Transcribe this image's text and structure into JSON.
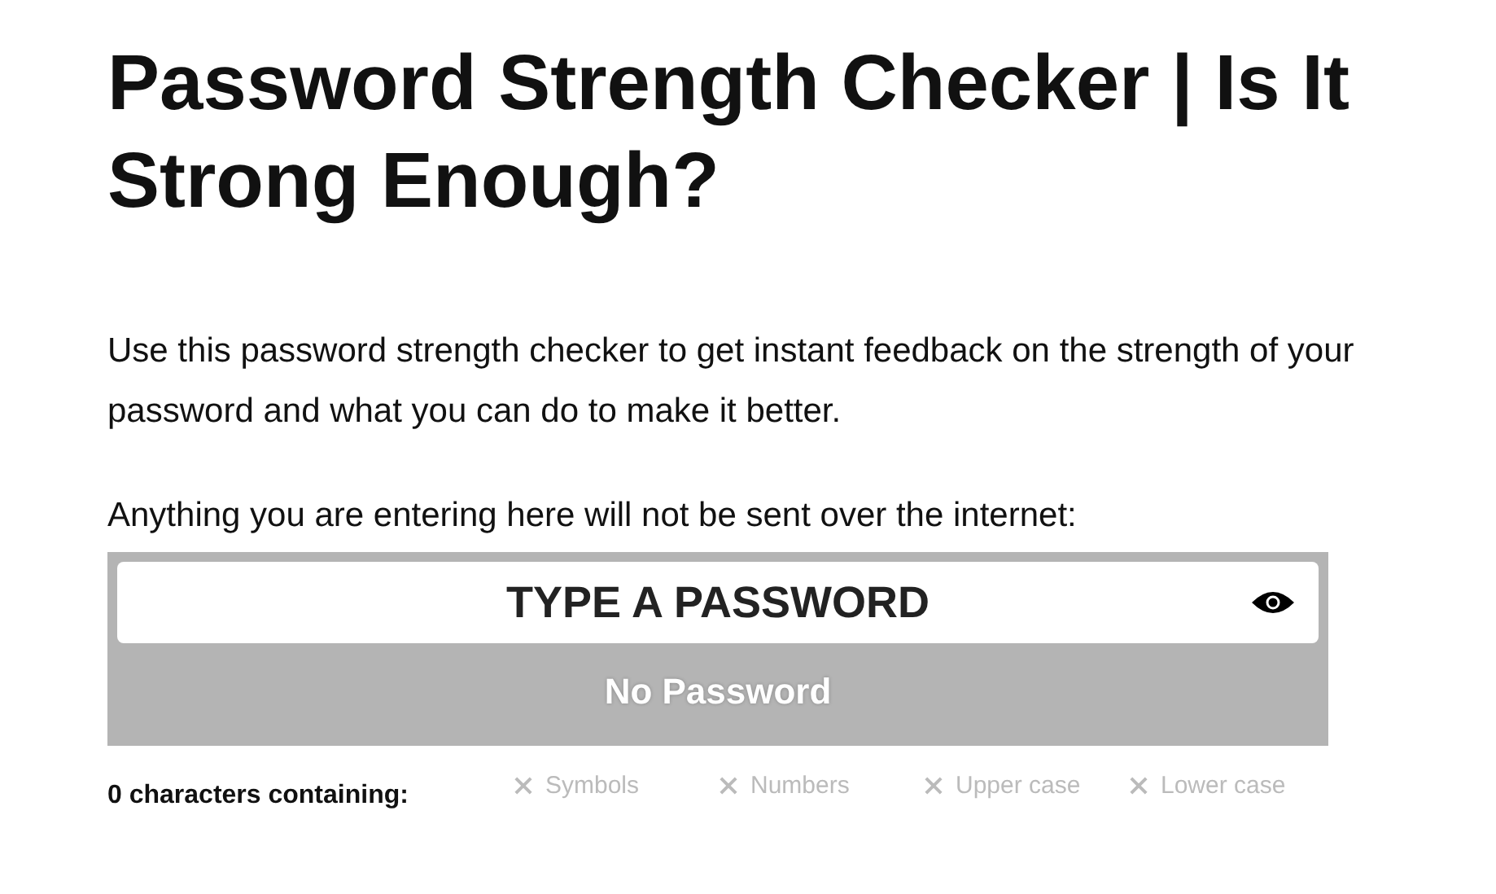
{
  "title": "Password Strength Checker | Is It Strong Enough?",
  "intro": "Use this password strength checker to get instant feedback on the strength of your password and what you can do to make it better.",
  "notice": "Anything you are entering here will not be sent over the internet:",
  "password_field": {
    "placeholder": "TYPE A PASSWORD",
    "visible": false
  },
  "strength": {
    "label": "No Password",
    "level": 0
  },
  "summary": "0 characters containing:",
  "criteria": [
    {
      "label": "Symbols",
      "met": false
    },
    {
      "label": "Numbers",
      "met": false
    },
    {
      "label": "Upper case",
      "met": false
    },
    {
      "label": "Lower case",
      "met": false
    }
  ]
}
